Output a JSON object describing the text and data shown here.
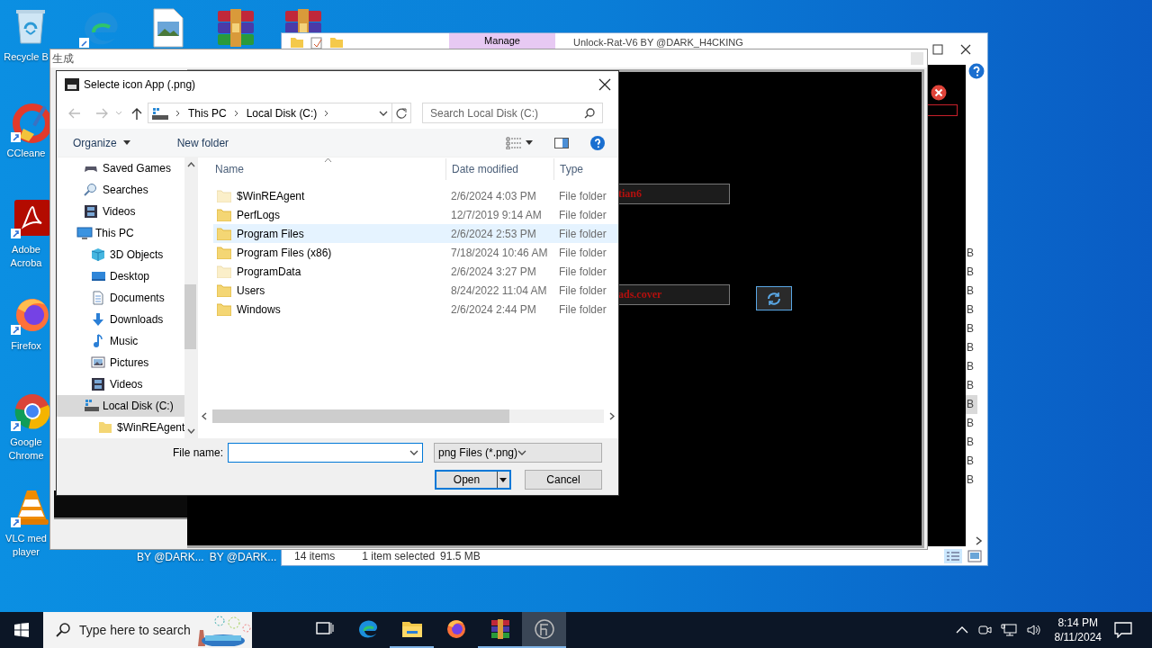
{
  "desktop": {
    "icons": [
      {
        "kind": "recycle",
        "label": "Recycle B"
      },
      {
        "kind": "ccleaner",
        "label": "CCleane"
      },
      {
        "kind": "acrobat",
        "label": "Adobe Acroba"
      },
      {
        "kind": "firefox",
        "label": "Firefox"
      },
      {
        "kind": "chrome",
        "label": "Google Chrome"
      },
      {
        "kind": "vlc",
        "label": "VLC med player"
      }
    ],
    "top_icons": [
      {
        "kind": "edge"
      },
      {
        "kind": "image"
      },
      {
        "kind": "winrar"
      },
      {
        "kind": "winrar"
      }
    ],
    "bottom_labels": [
      "BY @DARK...",
      "BY @DARK..."
    ]
  },
  "explorer": {
    "ribbon_tab": "Manage",
    "title": "Unlock-Rat-V6 BY @DARK_H4CKING",
    "size_column": [
      {
        "text": "B",
        "selected": false
      },
      {
        "text": "B",
        "selected": false
      },
      {
        "text": "B",
        "selected": false
      },
      {
        "text": "B",
        "selected": false
      },
      {
        "text": "B",
        "selected": false
      },
      {
        "text": "B",
        "selected": false
      },
      {
        "text": "B",
        "selected": false
      },
      {
        "text": "B",
        "selected": false
      },
      {
        "text": "B",
        "selected": true
      },
      {
        "text": "B",
        "selected": false
      },
      {
        "text": "B",
        "selected": false
      },
      {
        "text": "B",
        "selected": false
      },
      {
        "text": "B",
        "selected": false
      }
    ],
    "status_bar": {
      "count": "14 items",
      "selection": "1 item selected",
      "size": "91.5 MB"
    }
  },
  "app": {
    "title": "生成",
    "fields": [
      {
        "value": "tian6"
      },
      {
        "value": "ads.cover"
      }
    ]
  },
  "dialog": {
    "title": "Selecte icon App (.png)",
    "path": [
      "This PC",
      "Local Disk (C:)"
    ],
    "search_placeholder": "Search Local Disk (C:)",
    "toolbar": {
      "organize": "Organize",
      "new_folder": "New folder"
    },
    "nav": [
      {
        "label": "Saved Games",
        "kind": "games",
        "selected": false
      },
      {
        "label": "Searches",
        "kind": "search",
        "selected": false
      },
      {
        "label": "Videos",
        "kind": "videos",
        "selected": false
      },
      {
        "label": "This PC",
        "kind": "pc",
        "selected": false,
        "children": [
          {
            "label": "3D Objects",
            "kind": "cube",
            "selected": false
          },
          {
            "label": "Desktop",
            "kind": "desktop",
            "selected": false
          },
          {
            "label": "Documents",
            "kind": "documents",
            "selected": false
          },
          {
            "label": "Downloads",
            "kind": "downloads",
            "selected": false
          },
          {
            "label": "Music",
            "kind": "music",
            "selected": false
          },
          {
            "label": "Pictures",
            "kind": "pictures",
            "selected": false
          },
          {
            "label": "Videos",
            "kind": "videos",
            "selected": false
          },
          {
            "label": "Local Disk (C:)",
            "kind": "drive",
            "selected": true,
            "children": [
              {
                "label": "$WinREAgent",
                "kind": "folder",
                "selected": false
              }
            ]
          }
        ]
      }
    ],
    "columns": [
      "Name",
      "Date modified",
      "Type"
    ],
    "files": [
      {
        "name": "$WinREAgent",
        "date": "2/6/2024 4:03 PM",
        "type": "File folder",
        "hidden": true,
        "selected": false
      },
      {
        "name": "PerfLogs",
        "date": "12/7/2019 9:14 AM",
        "type": "File folder",
        "hidden": false,
        "selected": false
      },
      {
        "name": "Program Files",
        "date": "2/6/2024 2:53 PM",
        "type": "File folder",
        "hidden": false,
        "selected": true
      },
      {
        "name": "Program Files (x86)",
        "date": "7/18/2024 10:46 AM",
        "type": "File folder",
        "hidden": false,
        "selected": false
      },
      {
        "name": "ProgramData",
        "date": "2/6/2024 3:27 PM",
        "type": "File folder",
        "hidden": true,
        "selected": false
      },
      {
        "name": "Users",
        "date": "8/24/2022 11:04 AM",
        "type": "File folder",
        "hidden": false,
        "selected": false
      },
      {
        "name": "Windows",
        "date": "2/6/2024 2:44 PM",
        "type": "File folder",
        "hidden": false,
        "selected": false
      }
    ],
    "file_name_label": "File name:",
    "file_type": "png Files (*.png)",
    "buttons": {
      "open": "Open",
      "cancel": "Cancel"
    }
  },
  "taskbar": {
    "search_placeholder": "Type here to search",
    "apps": [
      {
        "kind": "taskview",
        "running": false,
        "selected": false
      },
      {
        "kind": "edge",
        "running": false,
        "selected": false
      },
      {
        "kind": "explorer",
        "running": true,
        "selected": false
      },
      {
        "kind": "firefox",
        "running": false,
        "selected": false
      },
      {
        "kind": "winrar",
        "running": true,
        "selected": false
      },
      {
        "kind": "app",
        "running": true,
        "selected": true
      }
    ],
    "time": "8:14 PM",
    "date": "8/11/2024"
  }
}
